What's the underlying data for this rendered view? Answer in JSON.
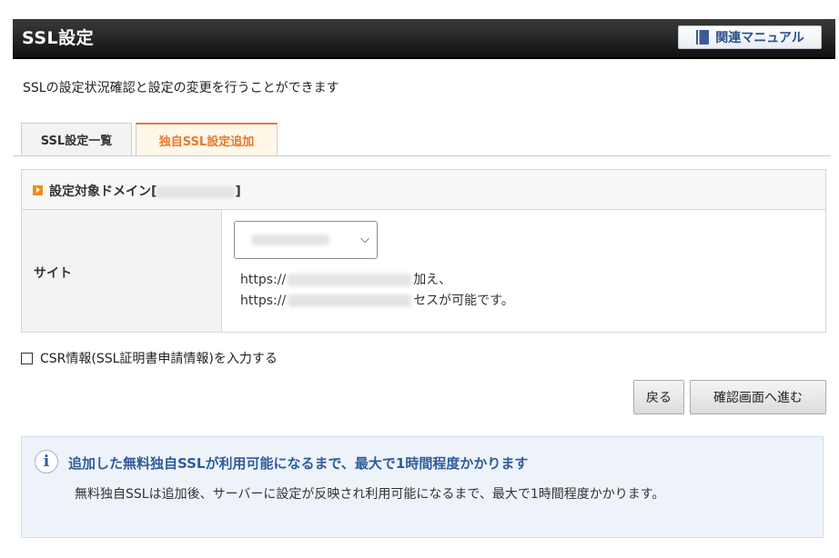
{
  "header": {
    "title": "SSL設定",
    "manual_button": "関連マニュアル"
  },
  "intro": "SSLの設定状況確認と設定の変更を行うことができます",
  "tabs": [
    {
      "label": "SSL設定一覧",
      "active": false
    },
    {
      "label": "独自SSL設定追加",
      "active": true
    }
  ],
  "panel": {
    "title_prefix": "設定対象ドメイン[",
    "title_suffix": "]",
    "site_label": "サイト",
    "note_line1_prefix": "https://",
    "note_line1_suffix": "加え、",
    "note_line2_prefix": "https://",
    "note_line2_suffix": "セスが可能です。"
  },
  "csr_label": "CSR情報(SSL証明書申請情報)を入力する",
  "buttons": {
    "back": "戻る",
    "next": "確認画面へ進む"
  },
  "info": {
    "title": "追加した無料独自SSLが利用可能になるまで、最大で1時間程度かかります",
    "body": "無料独自SSLは追加後、サーバーに設定が反映され利用可能になるまで、最大で1時間程度かかります。"
  },
  "colors": {
    "accent_orange": "#e8792a",
    "info_blue": "#2f5c9a",
    "header_dark": "#1a1a1a"
  }
}
